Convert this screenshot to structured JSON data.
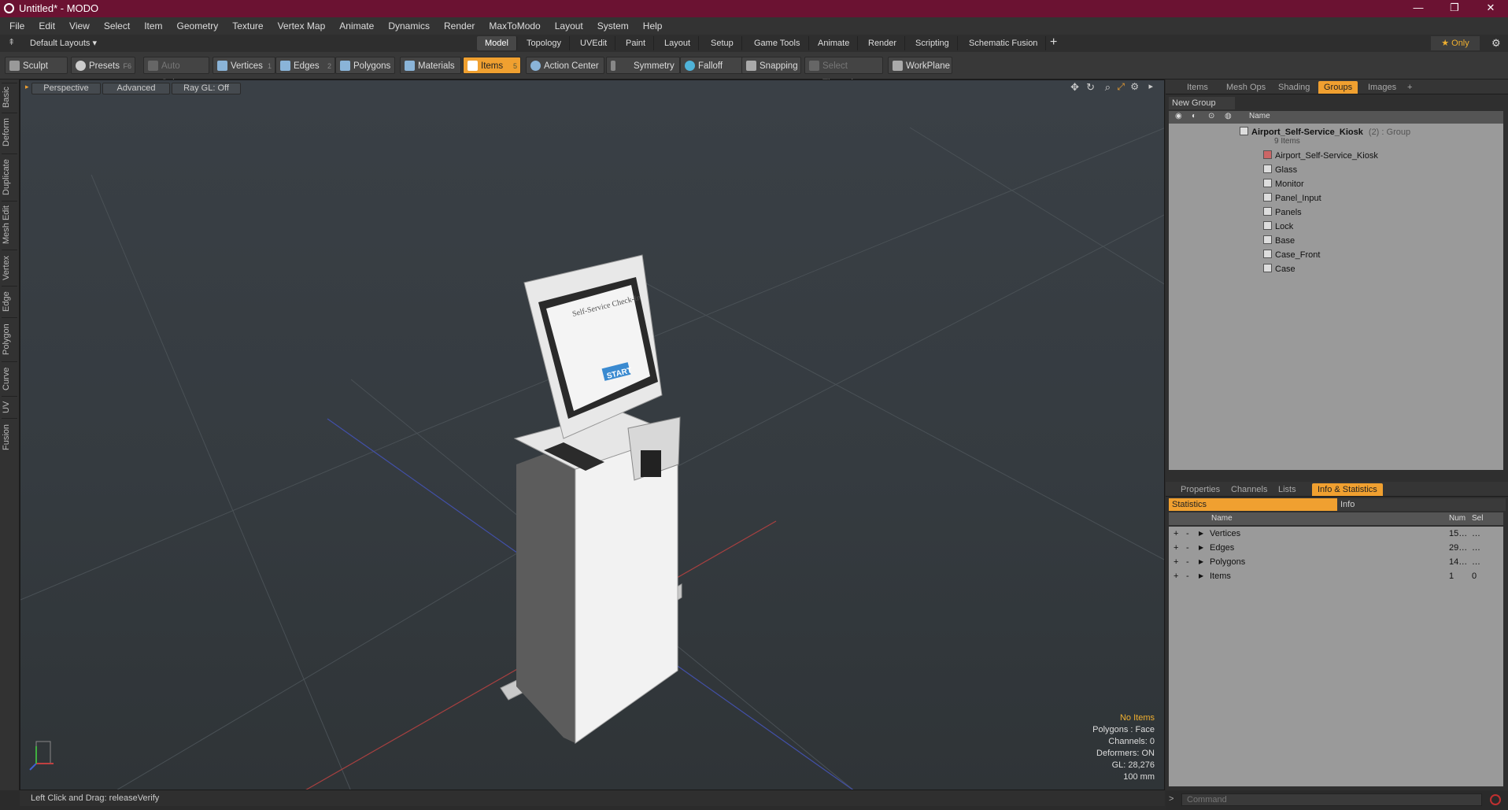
{
  "window": {
    "title": "Untitled* - MODO",
    "min": "—",
    "max": "❐",
    "close": "✕"
  },
  "menu": [
    "File",
    "Edit",
    "View",
    "Select",
    "Item",
    "Geometry",
    "Texture",
    "Vertex Map",
    "Animate",
    "Dynamics",
    "Render",
    "MaxToModo",
    "Layout",
    "System",
    "Help"
  ],
  "layout_bar": {
    "preset": "Default Layouts ▾",
    "tabs": [
      "Model",
      "Topology",
      "UVEdit",
      "Paint",
      "Layout",
      "Setup",
      "Game Tools",
      "Animate",
      "Render",
      "Scripting",
      "Schematic Fusion"
    ],
    "active_tab": "Model",
    "add": "+",
    "only": "★ Only"
  },
  "toolbar": {
    "sculpt": "Sculpt",
    "presets": "Presets",
    "presets_key": "F6",
    "auto_select": "Auto Select",
    "vertices": "Vertices",
    "vertices_n": "1",
    "edges": "Edges",
    "edges_n": "2",
    "polygons": "Polygons",
    "materials": "Materials",
    "items": "Items",
    "items_n": "5",
    "action_center": "Action Center",
    "symmetry": "Symmetry",
    "falloff": "Falloff",
    "snapping": "Snapping",
    "select_through": "Select Through",
    "workplane": "WorkPlane"
  },
  "vtabs": [
    "Basic",
    "Deform",
    "Duplicate",
    "Mesh Edit",
    "Vertex",
    "Edge",
    "Polygon",
    "Curve",
    "UV",
    "Fusion"
  ],
  "viewport": {
    "view": "Perspective",
    "shading": "Advanced",
    "raygl": "Ray GL: Off",
    "screen_title": "Self-Service Check-In",
    "screen_button": "START",
    "overlay": {
      "items": "No Items",
      "polygons": "Polygons : Face",
      "channels": "Channels: 0",
      "deformers": "Deformers: ON",
      "gl": "GL: 28,276",
      "size": "100 mm"
    }
  },
  "status": {
    "text": "Left Click and Drag:  releaseVerify"
  },
  "top_panel": {
    "tabs": [
      "Items",
      "Mesh Ops",
      "Shading",
      "Groups",
      "Images"
    ],
    "active_tab": "Groups",
    "new_group": "New Group",
    "name_col": "Name",
    "group_name": "Airport_Self-Service_Kiosk",
    "group_suffix": "(2) : Group",
    "group_count": "9 Items",
    "children": [
      "Airport_Self-Service_Kiosk",
      "Glass",
      "Monitor",
      "Panel_Input",
      "Panels",
      "Lock",
      "Base",
      "Case_Front",
      "Case"
    ]
  },
  "bottom_panel": {
    "tabs": [
      "Properties",
      "Channels",
      "Lists",
      "Info & Statistics"
    ],
    "active_tab": "Info & Statistics",
    "statistics": "Statistics",
    "info": "Info",
    "cols": {
      "name": "Name",
      "num": "Num",
      "sel": "Sel"
    },
    "rows": [
      {
        "name": "Vertices",
        "num": "15…",
        "sel": "…"
      },
      {
        "name": "Edges",
        "num": "29…",
        "sel": "…"
      },
      {
        "name": "Polygons",
        "num": "14…",
        "sel": "…"
      },
      {
        "name": "Items",
        "num": "1",
        "sel": "0"
      }
    ]
  },
  "command": {
    "placeholder": "Command"
  }
}
